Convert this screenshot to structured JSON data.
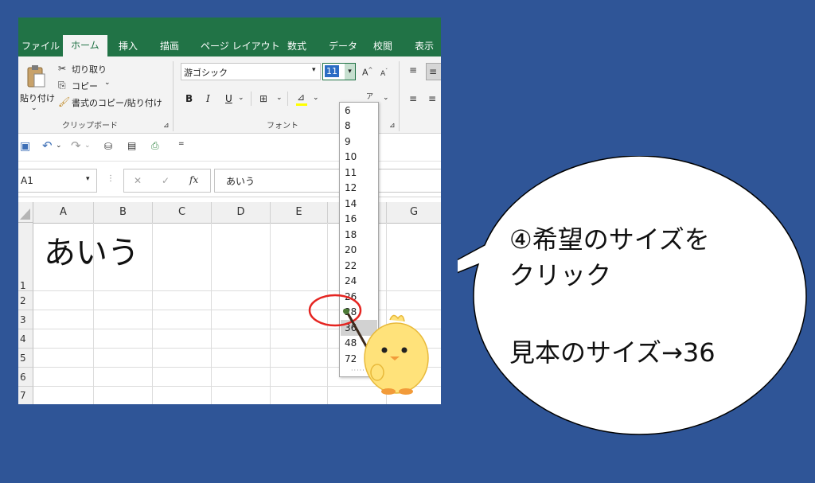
{
  "tabs": [
    "ファイル",
    "ホーム",
    "挿入",
    "描画",
    "ページ レイアウト",
    "数式",
    "データ",
    "校閲",
    "表示"
  ],
  "clipboard": {
    "paste_label": "貼り付け",
    "cut_label": "切り取り",
    "copy_label": "コピー",
    "format_painter_label": "書式のコピー/貼り付け",
    "group_label": "クリップボード"
  },
  "font": {
    "name": "游ゴシック",
    "size": "11",
    "group_label": "フォント",
    "bold": "B",
    "italic": "I",
    "underline": "U"
  },
  "formula_bar": {
    "name_box": "A1",
    "content": "あいう"
  },
  "grid": {
    "columns": [
      "A",
      "B",
      "C",
      "D",
      "E",
      "F",
      "G"
    ],
    "rows": [
      "1",
      "2",
      "3",
      "4",
      "5",
      "6",
      "7"
    ],
    "a1_value": "あいう"
  },
  "size_dropdown": {
    "items": [
      "6",
      "8",
      "9",
      "10",
      "11",
      "12",
      "14",
      "16",
      "18",
      "20",
      "22",
      "24",
      "26",
      "28",
      "36",
      "48",
      "72"
    ],
    "highlighted": "36"
  },
  "callout": {
    "line1": "④希望のサイズを",
    "line2": "クリック",
    "line3": "見本のサイズ→36"
  },
  "colors": {
    "background": "#2f5597",
    "excel_green": "#217346",
    "highlight_circle": "#e52521"
  }
}
